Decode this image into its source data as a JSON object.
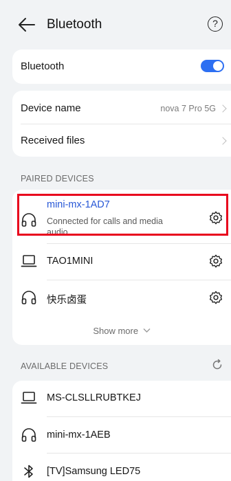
{
  "header": {
    "title": "Bluetooth",
    "help": "?"
  },
  "bluetooth": {
    "label": "Bluetooth",
    "enabled": true
  },
  "device_info": {
    "device_name_label": "Device name",
    "device_name_value": "nova 7 Pro 5G",
    "received_files_label": "Received files"
  },
  "paired": {
    "heading": "PAIRED DEVICES",
    "devices": [
      {
        "name": "mini-mx-1AD7",
        "status": "Connected for calls and media audio",
        "icon": "headphones-icon"
      },
      {
        "name": "TAO1MINI",
        "icon": "laptop-icon"
      },
      {
        "name": "快乐卤蛋",
        "icon": "headphones-icon"
      }
    ],
    "show_more": "Show more"
  },
  "available": {
    "heading": "AVAILABLE DEVICES",
    "devices": [
      {
        "name": "MS-CLSLLRUBTKEJ",
        "icon": "laptop-icon"
      },
      {
        "name": "mini-mx-1AEB",
        "icon": "headphones-icon"
      },
      {
        "name": "[TV]Samsung LED75",
        "icon": "bluetooth-icon"
      }
    ]
  },
  "colors": {
    "accent": "#2d6ff2",
    "active_text": "#2757d6",
    "highlight": "#e8001c",
    "background": "#f1f3f5"
  }
}
